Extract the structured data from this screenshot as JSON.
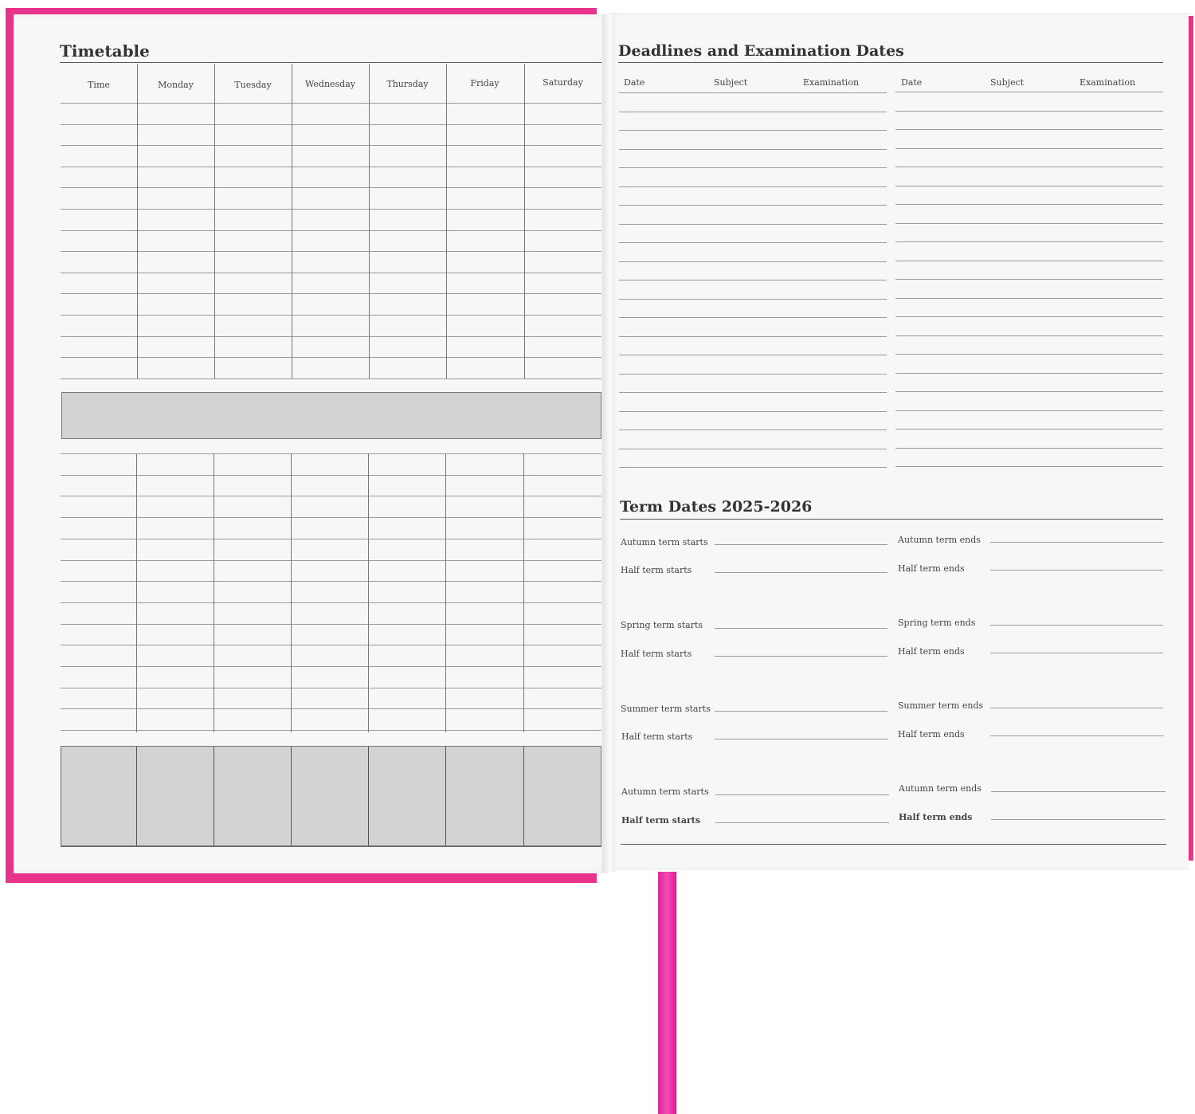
{
  "timetable": {
    "title": "Timetable",
    "columns": [
      "Time",
      "Monday",
      "Tuesday",
      "Wednesday",
      "Thursday",
      "Friday",
      "Saturday"
    ]
  },
  "deadlines": {
    "title": "Deadlines and Examination Dates",
    "columns": [
      "Date",
      "Subject",
      "Examination",
      "Date",
      "Subject",
      "Examination"
    ]
  },
  "term_dates": {
    "title": "Term Dates 2025-2026",
    "rows": [
      {
        "left": "Autumn term starts",
        "right": "Autumn term ends"
      },
      {
        "left": "Half term starts",
        "right": "Half term ends"
      },
      {
        "left": "Spring term starts",
        "right": "Spring term ends"
      },
      {
        "left": "Half term starts",
        "right": "Half term ends"
      },
      {
        "left": "Summer term starts",
        "right": "Summer term ends"
      },
      {
        "left": "Half term starts",
        "right": "Half term ends"
      },
      {
        "left": "Autumn term starts",
        "right": "Autumn term ends"
      },
      {
        "left": "Half term starts",
        "right": "Half term ends"
      }
    ]
  },
  "colors": {
    "cover": "#e8338a",
    "ribbon": "#f24cb4",
    "page": "#f7f7f7",
    "shaded": "#d3d3d3"
  }
}
